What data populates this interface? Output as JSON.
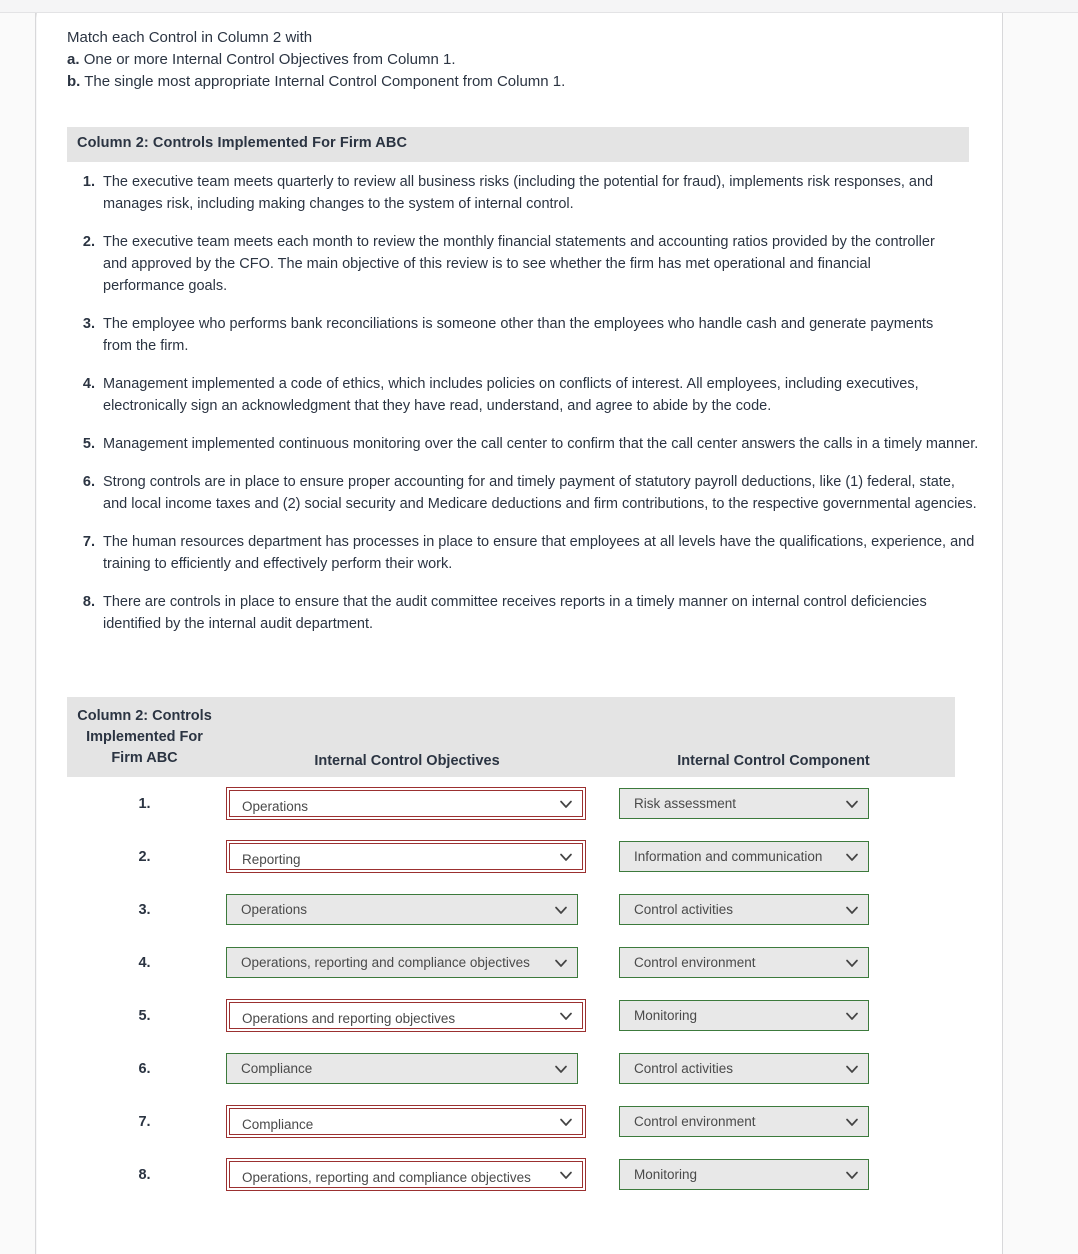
{
  "intro": {
    "line1": "Match each Control in Column 2 with",
    "line2_label": "a.",
    "line2_text": "One or more Internal Control Objectives from Column 1.",
    "line3_label": "b.",
    "line3_text": "The single most appropriate Internal Control Component from Column 1."
  },
  "section": {
    "title": "Column 2: Controls Implemented For Firm ABC"
  },
  "controls": [
    {
      "num": "1.",
      "text": "The executive team meets quarterly to review all business risks (including the potential for fraud), implements risk responses, and manages risk, including making changes to the system of internal control."
    },
    {
      "num": "2.",
      "text": "The executive team meets each month to review the monthly financial statements and accounting ratios provided by the controller and approved by the CFO. The main objective of this review is to see whether the firm has met operational and financial performance goals."
    },
    {
      "num": "3.",
      "text": "The employee who performs bank reconciliations is someone other than the employees who handle cash and generate payments from the firm."
    },
    {
      "num": "4.",
      "text": "Management implemented a code of ethics, which includes policies on conflicts of interest. All employees, including executives, electronically sign an acknowledgment that they have read, understand, and agree to abide by the code."
    },
    {
      "num": "5.",
      "text": "Management implemented continuous monitoring over the call center to confirm that the call center answers the calls in a timely manner."
    },
    {
      "num": "6.",
      "text": "Strong controls are in place to ensure proper accounting for and timely payment of statutory payroll deductions, like (1) federal, state, and local income taxes and (2) social security and Medicare deductions and firm contributions, to the respective governmental agencies."
    },
    {
      "num": "7.",
      "text": "The human resources department has processes in place to ensure that employees at all levels have the qualifications, experience, and training to efficiently and effectively perform their work."
    },
    {
      "num": "8.",
      "text": "There are controls in place to ensure that the audit committee receives reports in a timely manner on internal control deficiencies identified by the internal audit department."
    }
  ],
  "table": {
    "header": {
      "col1_line1": "Column 2: Controls",
      "col1_line2": "Implemented For",
      "col1_line3": "Firm ABC",
      "col2": "Internal Control Objectives",
      "col3": "Internal Control Component"
    },
    "rows": [
      {
        "num": "1.",
        "objective": "Operations",
        "objective_state": "incorrect",
        "component": "Risk assessment",
        "component_state": "correct"
      },
      {
        "num": "2.",
        "objective": "Reporting",
        "objective_state": "incorrect",
        "component": "Information and communication",
        "component_state": "correct"
      },
      {
        "num": "3.",
        "objective": "Operations",
        "objective_state": "correct",
        "component": "Control activities",
        "component_state": "correct"
      },
      {
        "num": "4.",
        "objective": "Operations, reporting and compliance objectives",
        "objective_state": "correct",
        "component": "Control environment",
        "component_state": "correct"
      },
      {
        "num": "5.",
        "objective": "Operations and reporting objectives",
        "objective_state": "incorrect",
        "component": "Monitoring",
        "component_state": "correct"
      },
      {
        "num": "6.",
        "objective": "Compliance",
        "objective_state": "correct",
        "component": "Control activities",
        "component_state": "correct"
      },
      {
        "num": "7.",
        "objective": "Compliance",
        "objective_state": "incorrect",
        "component": "Control environment",
        "component_state": "correct"
      },
      {
        "num": "8.",
        "objective": "Operations, reporting and compliance objectives",
        "objective_state": "incorrect",
        "component": "Monitoring",
        "component_state": "correct"
      }
    ]
  },
  "colors": {
    "correct_border": "#3c7a3c",
    "incorrect_border": "#9b3030",
    "header_bg": "#e4e4e4",
    "select_bg": "#e8e8e8",
    "text": "#2b3442"
  }
}
